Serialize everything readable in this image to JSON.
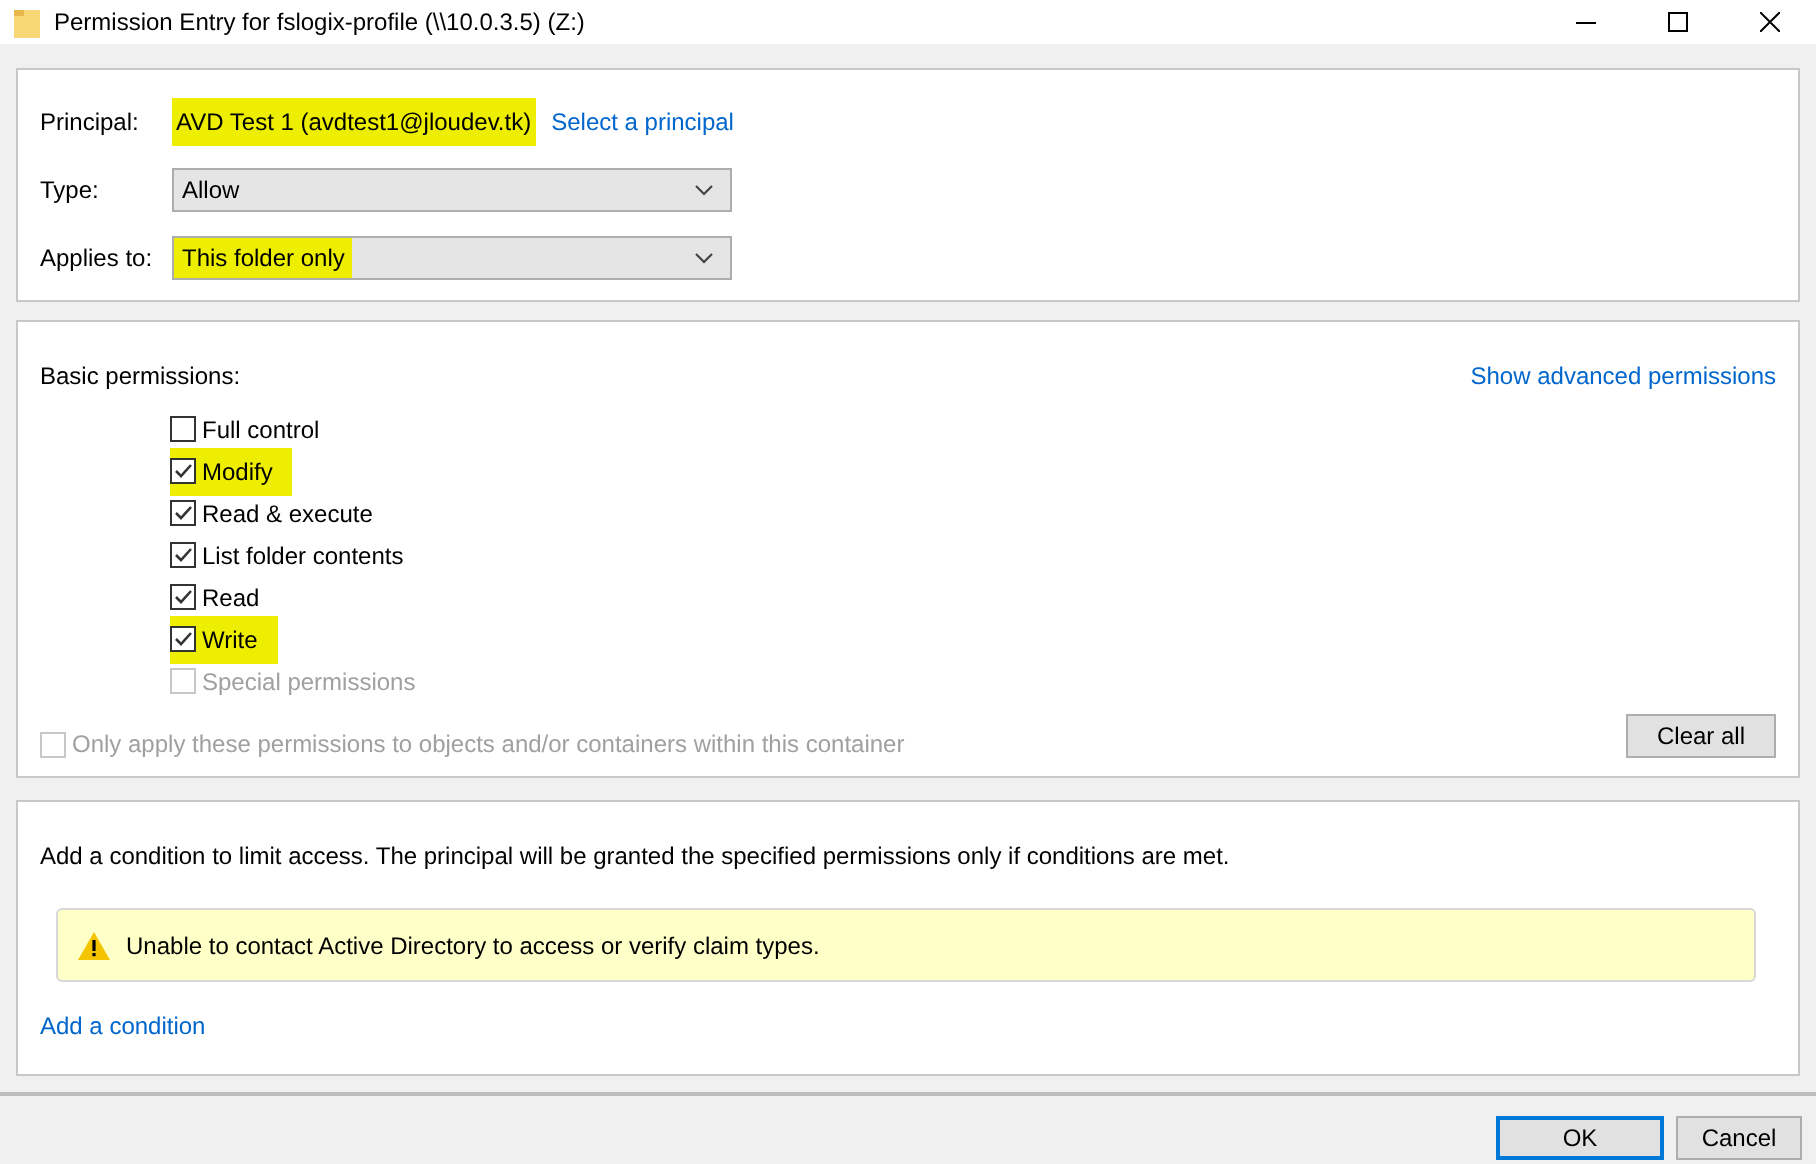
{
  "window": {
    "title": "Permission Entry for fslogix-profile (\\\\10.0.3.5) (Z:)"
  },
  "principal": {
    "label": "Principal:",
    "value": "AVD Test 1 (avdtest1@jloudev.tk)",
    "highlighted": true,
    "link": "Select a principal"
  },
  "type": {
    "label": "Type:",
    "value": "Allow",
    "highlighted": false
  },
  "applies_to": {
    "label": "Applies to:",
    "value": "This folder only",
    "highlighted": true
  },
  "basic_permissions": {
    "label": "Basic permissions:",
    "advanced_link": "Show advanced permissions",
    "items": [
      {
        "label": "Full control",
        "checked": false,
        "disabled": false,
        "highlighted": false
      },
      {
        "label": "Modify",
        "checked": true,
        "disabled": false,
        "highlighted": true
      },
      {
        "label": "Read & execute",
        "checked": true,
        "disabled": false,
        "highlighted": false
      },
      {
        "label": "List folder contents",
        "checked": true,
        "disabled": false,
        "highlighted": false
      },
      {
        "label": "Read",
        "checked": true,
        "disabled": false,
        "highlighted": false
      },
      {
        "label": "Write",
        "checked": true,
        "disabled": false,
        "highlighted": true
      },
      {
        "label": "Special permissions",
        "checked": false,
        "disabled": true,
        "highlighted": false
      }
    ],
    "only_apply": {
      "label": "Only apply these permissions to objects and/or containers within this container",
      "checked": false,
      "disabled": true
    },
    "clear_button": "Clear all"
  },
  "conditions": {
    "description": "Add a condition to limit access. The principal will be granted the specified permissions only if conditions are met.",
    "warning": "Unable to contact Active Directory to access or verify claim types.",
    "link": "Add a condition"
  },
  "buttons": [
    "OK",
    "Cancel"
  ]
}
